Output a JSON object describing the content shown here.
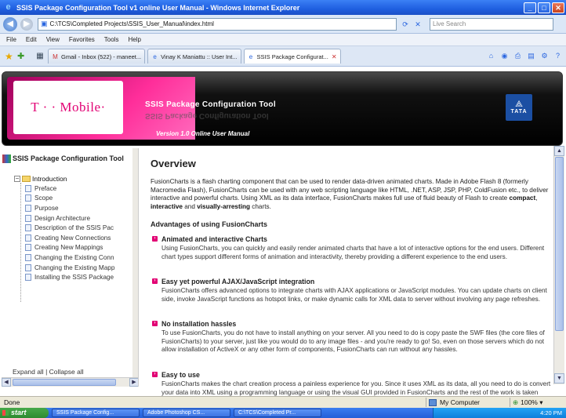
{
  "window": {
    "title": "SSIS Package Configuration Tool v1 online User Manual - Windows Internet Explorer",
    "minimize": "_",
    "maximize": "□",
    "close": "✕"
  },
  "address": {
    "url": "C:\\TCS\\Completed Projects\\SSIS_User_Manual\\index.html",
    "search_placeholder": "Live Search"
  },
  "menu": [
    "File",
    "Edit",
    "View",
    "Favorites",
    "Tools",
    "Help"
  ],
  "tabs": [
    {
      "label": "Gmail - Inbox (522) - maneet...",
      "active": false
    },
    {
      "label": "Vinay K Maniattu :: User Int...",
      "active": false
    },
    {
      "label": "SSIS Package Configurat...",
      "active": true
    }
  ],
  "banner": {
    "logo": "T · · Mobile·",
    "title": "SSIS Package Configuration Tool",
    "version": "Version 1.0  Online User Manual",
    "company": "TATA"
  },
  "tree": {
    "title": "SSIS Package Configuration Tool",
    "root": "Introduction",
    "items": [
      "Preface",
      "Scope",
      "Purpose",
      "Design Architecture",
      "Description of the SSIS Pac",
      "Creating New Connections",
      "Creating New Mappings",
      "Changing the Existing Conn",
      "Changing the Existing Mapp",
      "Installing the SSIS Package"
    ],
    "expand_all": "Expand all",
    "separator": "|",
    "collapse_all": "Collapse all"
  },
  "content": {
    "title": "Overview",
    "intro_part1": "FusionCharts is a flash charting component that can be used to render data-driven animated charts. Made in Adobe Flash 8 (formerly Macromedia Flash), FusionCharts can be used with any web scripting language like HTML, .NET, ASP, JSP, PHP, ColdFusion etc., to deliver interactive and powerful charts. Using XML as its data interface, FusionCharts makes full use of fluid beauty of Flash to create ",
    "intro_b1": "compact",
    "intro_sep1": ", ",
    "intro_b2": "interactive",
    "intro_sep2": " and ",
    "intro_b3": "visually-arresting",
    "intro_end": " charts.",
    "adv_heading": "Advantages of using FusionCharts",
    "sections": [
      {
        "heading": "Animated and interactive Charts",
        "text": "Using FusionCharts, you can quickly and easily render animated charts that have a lot of interactive options for the end users. Different chart types support different forms of animation and interactivity, thereby providing a different experience to the end users."
      },
      {
        "heading": "Easy yet powerful AJAX/JavaScript integration",
        "text": "FusionCharts offers advanced options to integrate charts with AJAX applications or JavaScript modules. You can update charts on client side, invoke JavaScript functions as hotspot links, or make dynamic calls for XML data to server without involving any page refreshes."
      },
      {
        "heading": "No installation hassles",
        "text": "To use FusionCharts, you do not have to install anything on your server. All you need to do is copy paste the SWF files (the core files of FusionCharts) to your server, just like you would do to any image files - and you're ready to go! So, even on those servers which do not allow installation of ActiveX or any other form of components, FusionCharts can run without any hassles."
      },
      {
        "heading": "Easy to use",
        "text": "FusionCharts makes the chart creation process a painless experience for you. Since it uses XML as its data, all you need to do is convert your data into XML using a programming language or using the visual GUI provided in FusionCharts and the rest of the work is taken care of by FusionCharts."
      }
    ]
  },
  "status": {
    "text": "Done",
    "zone": "My Computer",
    "zoom": "100%"
  },
  "taskbar": {
    "start": "start",
    "items": [
      "SSIS Package Config...",
      "Adobe Photoshop CS...",
      "C:\\TCS\\Completed Pr..."
    ],
    "clock": "4:20 PM"
  },
  "colors": {
    "brand_magenta": "#e20074",
    "ie_title_blue": "#1f5fe0",
    "tata_blue": "#1b4fa3"
  }
}
